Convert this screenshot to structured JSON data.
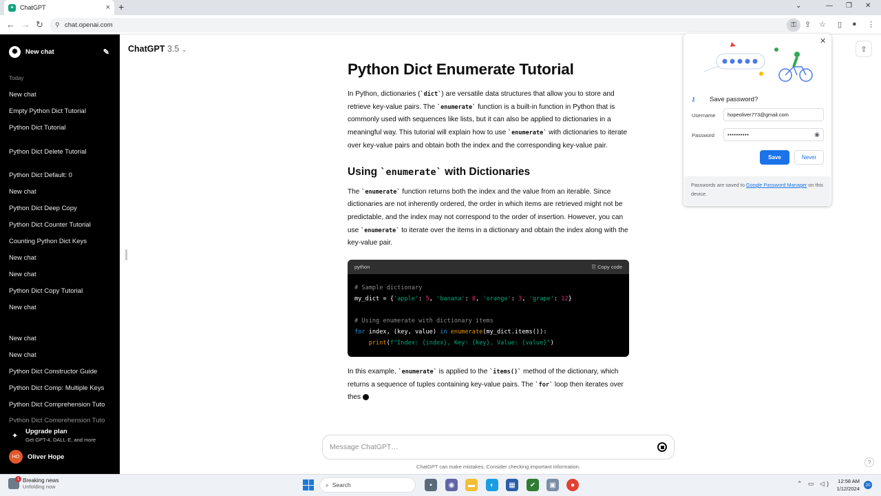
{
  "browser": {
    "tab_title": "ChatGPT",
    "url": "chat.openai.com"
  },
  "sidebar": {
    "new_chat": "New chat",
    "section_today": "Today",
    "items": [
      "New chat",
      "Empty Python Dict Tutorial",
      "Python Dict Tutorial",
      "Python Dict Delete Tutorial",
      "Python Dict Default: 0",
      "New chat",
      "Python Dict Deep Copy",
      "Python Dict Counter Tutorial",
      "Counting Python Dict Keys",
      "New chat",
      "New chat",
      "Python Dict Copy Tutorial",
      "New chat",
      "New chat",
      "New chat",
      "Python Dict Constructor Guide",
      "Python Dict Comp: Multiple Keys",
      "Python Dict Comprehension Tuto",
      "Python Dict Comprehension Tuto"
    ],
    "upgrade_title": "Upgrade plan",
    "upgrade_sub": "Get GPT-4, DALL·E, and more",
    "user_initials": "HO",
    "user_name": "Oliver Hope"
  },
  "header": {
    "model": "ChatGPT",
    "version": "3.5"
  },
  "article": {
    "title": "Python Dict Enumerate Tutorial",
    "p1": {
      "a": "In Python, dictionaries (",
      "c1": "`dict`",
      "b": ") are versatile data structures that allow you to store and retrieve key-value pairs. The ",
      "c2": "`enumerate`",
      "d": " function is a built-in function in Python that is commonly used with sequences like lists, but it can also be applied to dictionaries in a meaningful way. This tutorial will explain how to use ",
      "c3": "`enumerate`",
      "e": " with dictionaries to iterate over key-value pairs and obtain both the index and the corresponding key-value pair."
    },
    "h2": {
      "a": "Using ",
      "code": "`enumerate`",
      "b": " with Dictionaries"
    },
    "p2": {
      "a": "The ",
      "c1": "`enumerate`",
      "b": " function returns both the index and the value from an iterable. Since dictionaries are not inherently ordered, the order in which items are retrieved might not be predictable, and the index may not correspond to the order of insertion. However, you can use ",
      "c2": "`enumerate`",
      "c": " to iterate over the items in a dictionary and obtain the index along with the key-value pair."
    },
    "code": {
      "lang": "python",
      "copy_label": "Copy code"
    },
    "p3": {
      "a": "In this example, ",
      "c1": "`enumerate`",
      "b": " is applied to the ",
      "c2": "`items()`",
      "c": " method of the dictionary, which returns a sequence of tuples containing key-value pairs. The ",
      "c3": "`for`",
      "d": " loop then iterates over thes"
    }
  },
  "composer": {
    "placeholder": "Message ChatGPT…",
    "disclaimer": "ChatGPT can make mistakes. Consider checking important information."
  },
  "password_popup": {
    "title": "Save password?",
    "username_label": "Username",
    "username_value": "hopeoliver773@gmail.com",
    "password_label": "Password",
    "password_value": "••••••••••",
    "save": "Save",
    "never": "Never",
    "footer_a": "Passwords are saved to ",
    "footer_link": "Google Password Manager",
    "footer_b": " on this device."
  },
  "taskbar": {
    "news_title": "Breaking news",
    "news_sub": "Unfolding now",
    "news_badge": "1",
    "search": "Search",
    "time": "12:58 AM",
    "date": "1/12/2024",
    "notifications": "20"
  },
  "colors": {
    "accent": "#1a73e8",
    "chatgpt_green": "#10a37f",
    "sidebar_bg": "#000000",
    "avatar": "#e1582a"
  }
}
